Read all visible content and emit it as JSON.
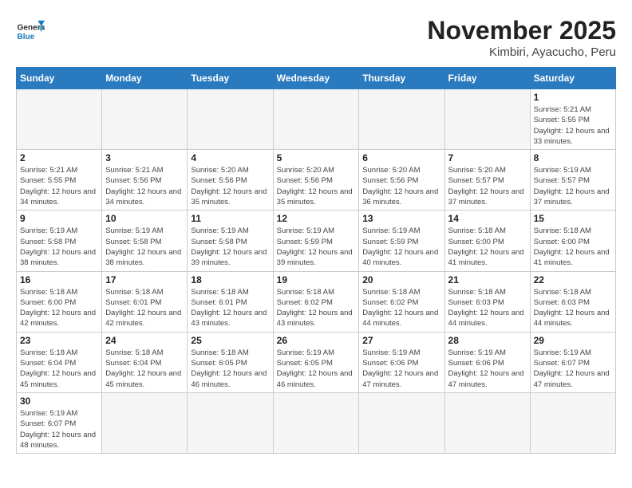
{
  "logo": {
    "line1": "General",
    "line2": "Blue"
  },
  "title": "November 2025",
  "subtitle": "Kimbiri, Ayacucho, Peru",
  "days_header": [
    "Sunday",
    "Monday",
    "Tuesday",
    "Wednesday",
    "Thursday",
    "Friday",
    "Saturday"
  ],
  "weeks": [
    [
      {
        "day": "",
        "info": ""
      },
      {
        "day": "",
        "info": ""
      },
      {
        "day": "",
        "info": ""
      },
      {
        "day": "",
        "info": ""
      },
      {
        "day": "",
        "info": ""
      },
      {
        "day": "",
        "info": ""
      },
      {
        "day": "1",
        "info": "Sunrise: 5:21 AM\nSunset: 5:55 PM\nDaylight: 12 hours and 33 minutes."
      }
    ],
    [
      {
        "day": "2",
        "info": "Sunrise: 5:21 AM\nSunset: 5:55 PM\nDaylight: 12 hours and 34 minutes."
      },
      {
        "day": "3",
        "info": "Sunrise: 5:21 AM\nSunset: 5:56 PM\nDaylight: 12 hours and 34 minutes."
      },
      {
        "day": "4",
        "info": "Sunrise: 5:20 AM\nSunset: 5:56 PM\nDaylight: 12 hours and 35 minutes."
      },
      {
        "day": "5",
        "info": "Sunrise: 5:20 AM\nSunset: 5:56 PM\nDaylight: 12 hours and 35 minutes."
      },
      {
        "day": "6",
        "info": "Sunrise: 5:20 AM\nSunset: 5:56 PM\nDaylight: 12 hours and 36 minutes."
      },
      {
        "day": "7",
        "info": "Sunrise: 5:20 AM\nSunset: 5:57 PM\nDaylight: 12 hours and 37 minutes."
      },
      {
        "day": "8",
        "info": "Sunrise: 5:19 AM\nSunset: 5:57 PM\nDaylight: 12 hours and 37 minutes."
      }
    ],
    [
      {
        "day": "9",
        "info": "Sunrise: 5:19 AM\nSunset: 5:58 PM\nDaylight: 12 hours and 38 minutes."
      },
      {
        "day": "10",
        "info": "Sunrise: 5:19 AM\nSunset: 5:58 PM\nDaylight: 12 hours and 38 minutes."
      },
      {
        "day": "11",
        "info": "Sunrise: 5:19 AM\nSunset: 5:58 PM\nDaylight: 12 hours and 39 minutes."
      },
      {
        "day": "12",
        "info": "Sunrise: 5:19 AM\nSunset: 5:59 PM\nDaylight: 12 hours and 39 minutes."
      },
      {
        "day": "13",
        "info": "Sunrise: 5:19 AM\nSunset: 5:59 PM\nDaylight: 12 hours and 40 minutes."
      },
      {
        "day": "14",
        "info": "Sunrise: 5:18 AM\nSunset: 6:00 PM\nDaylight: 12 hours and 41 minutes."
      },
      {
        "day": "15",
        "info": "Sunrise: 5:18 AM\nSunset: 6:00 PM\nDaylight: 12 hours and 41 minutes."
      }
    ],
    [
      {
        "day": "16",
        "info": "Sunrise: 5:18 AM\nSunset: 6:00 PM\nDaylight: 12 hours and 42 minutes."
      },
      {
        "day": "17",
        "info": "Sunrise: 5:18 AM\nSunset: 6:01 PM\nDaylight: 12 hours and 42 minutes."
      },
      {
        "day": "18",
        "info": "Sunrise: 5:18 AM\nSunset: 6:01 PM\nDaylight: 12 hours and 43 minutes."
      },
      {
        "day": "19",
        "info": "Sunrise: 5:18 AM\nSunset: 6:02 PM\nDaylight: 12 hours and 43 minutes."
      },
      {
        "day": "20",
        "info": "Sunrise: 5:18 AM\nSunset: 6:02 PM\nDaylight: 12 hours and 44 minutes."
      },
      {
        "day": "21",
        "info": "Sunrise: 5:18 AM\nSunset: 6:03 PM\nDaylight: 12 hours and 44 minutes."
      },
      {
        "day": "22",
        "info": "Sunrise: 5:18 AM\nSunset: 6:03 PM\nDaylight: 12 hours and 44 minutes."
      }
    ],
    [
      {
        "day": "23",
        "info": "Sunrise: 5:18 AM\nSunset: 6:04 PM\nDaylight: 12 hours and 45 minutes."
      },
      {
        "day": "24",
        "info": "Sunrise: 5:18 AM\nSunset: 6:04 PM\nDaylight: 12 hours and 45 minutes."
      },
      {
        "day": "25",
        "info": "Sunrise: 5:18 AM\nSunset: 6:05 PM\nDaylight: 12 hours and 46 minutes."
      },
      {
        "day": "26",
        "info": "Sunrise: 5:19 AM\nSunset: 6:05 PM\nDaylight: 12 hours and 46 minutes."
      },
      {
        "day": "27",
        "info": "Sunrise: 5:19 AM\nSunset: 6:06 PM\nDaylight: 12 hours and 47 minutes."
      },
      {
        "day": "28",
        "info": "Sunrise: 5:19 AM\nSunset: 6:06 PM\nDaylight: 12 hours and 47 minutes."
      },
      {
        "day": "29",
        "info": "Sunrise: 5:19 AM\nSunset: 6:07 PM\nDaylight: 12 hours and 47 minutes."
      }
    ],
    [
      {
        "day": "30",
        "info": "Sunrise: 5:19 AM\nSunset: 6:07 PM\nDaylight: 12 hours and 48 minutes."
      },
      {
        "day": "",
        "info": ""
      },
      {
        "day": "",
        "info": ""
      },
      {
        "day": "",
        "info": ""
      },
      {
        "day": "",
        "info": ""
      },
      {
        "day": "",
        "info": ""
      },
      {
        "day": "",
        "info": ""
      }
    ]
  ]
}
